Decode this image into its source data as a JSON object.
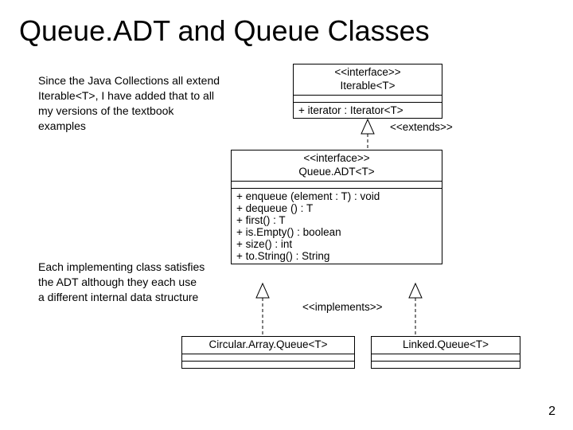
{
  "title": "Queue.ADT and Queue Classes",
  "notes": {
    "top": "Since the Java Collections all extend Iterable<T>, I have added that to all my versions of the textbook examples",
    "bottom": "Each implementing class satisfies the ADT although they each use a different internal data structure"
  },
  "iterable": {
    "stereotype": "<<interface>>",
    "name": "Iterable<T>",
    "op1": "+ iterator : Iterator<T>"
  },
  "queueadt": {
    "stereotype": "<<interface>>",
    "name": "Queue.ADT<T>",
    "op1": "+ enqueue (element : T) : void",
    "op2": "+ dequeue () : T",
    "op3": "+ first() : T",
    "op4": "+ is.Empty() : boolean",
    "op5": "+ size() : int",
    "op6": "+ to.String() : String"
  },
  "circular": {
    "name": "Circular.Array.Queue<T>"
  },
  "linked": {
    "name": "Linked.Queue<T>"
  },
  "labels": {
    "extends": "<<extends>>",
    "implements": "<<implements>>"
  },
  "pageNumber": "2"
}
